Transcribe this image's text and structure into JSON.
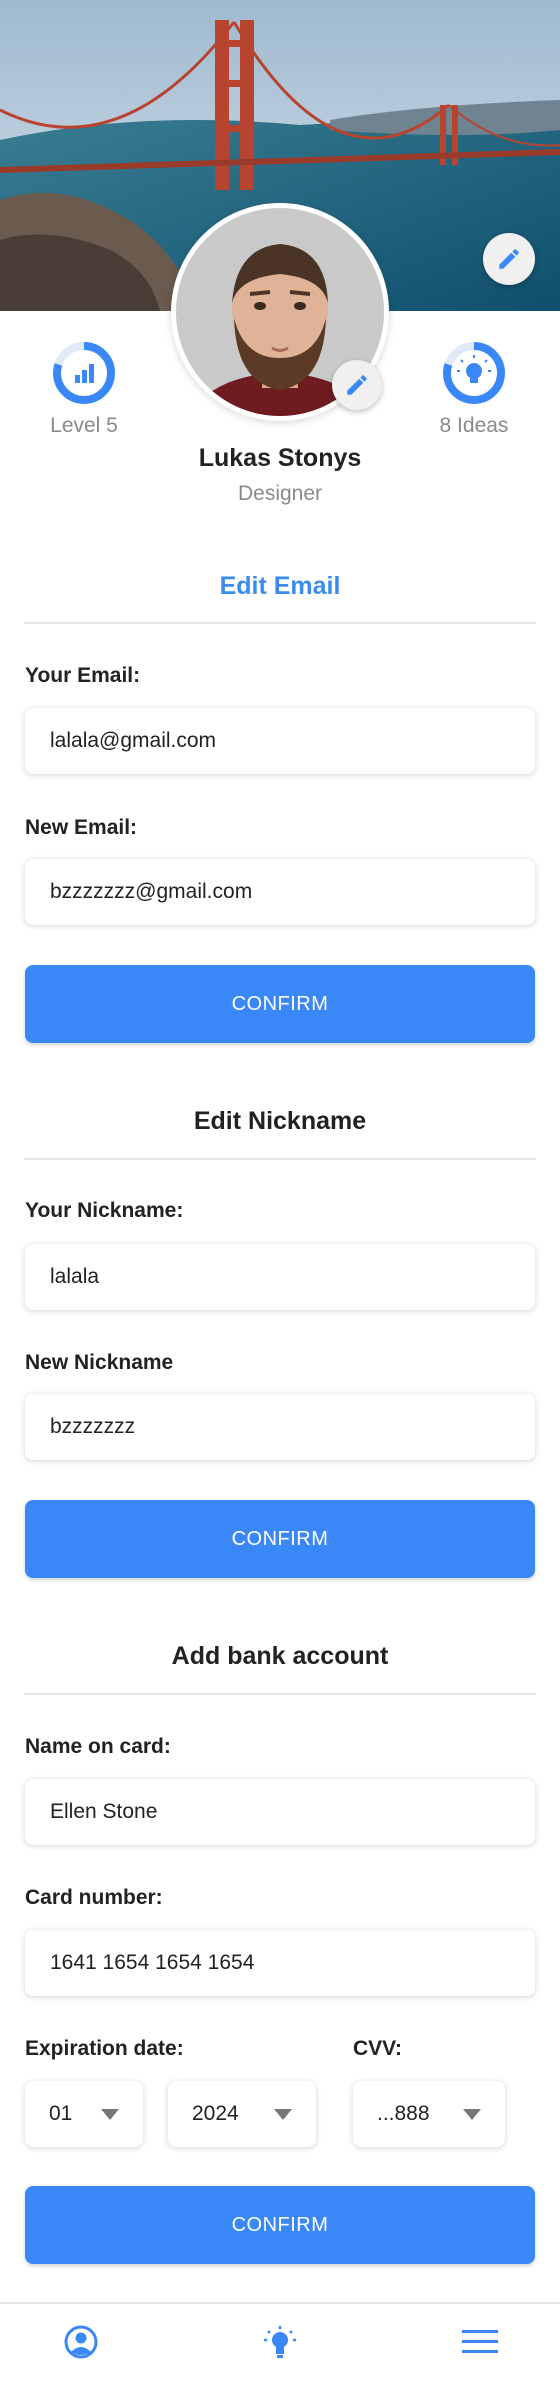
{
  "profile": {
    "name": "Lukas Stonys",
    "role": "Designer",
    "level_label": "Level 5",
    "ideas_label": "8 Ideas",
    "level_progress": 0.8,
    "ideas_progress": 0.8
  },
  "edit_email": {
    "title": "Edit Email",
    "current_label": "Your Email:",
    "current_value": "lalala@gmail.com",
    "new_label": "New Email:",
    "new_value": "bzzzzzzz@gmail.com",
    "confirm_label": "CONFIRM"
  },
  "edit_nickname": {
    "title": "Edit Nickname",
    "current_label": "Your Nickname:",
    "current_value": "lalala",
    "new_label": "New Nickname",
    "new_value": "bzzzzzzz",
    "confirm_label": "CONFIRM"
  },
  "bank": {
    "title": "Add bank account",
    "name_label": "Name on card:",
    "name_value": "Ellen Stone",
    "card_label": "Card number:",
    "card_value": "1641 1654 1654 1654",
    "expiry_label": "Expiration date:",
    "expiry_month": "01",
    "expiry_year": "2024",
    "cvv_label": "CVV:",
    "cvv_value": "...888",
    "confirm_label": "CONFIRM"
  },
  "icons": {
    "cover_edit": "pencil-icon",
    "avatar_edit": "pencil-icon",
    "level": "bar-chart-icon",
    "ideas": "lightbulb-icon",
    "tab_profile": "user-circle-icon",
    "tab_ideas": "lightbulb-icon",
    "tab_menu": "hamburger-menu-icon"
  },
  "colors": {
    "accent": "#3a87f7",
    "title_blue": "#3b8cf2",
    "muted_text": "#8a8a8a"
  }
}
